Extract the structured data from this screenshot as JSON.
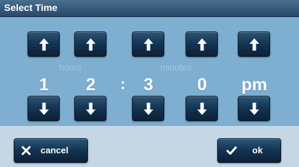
{
  "window": {
    "title": "Select Time"
  },
  "picker": {
    "hours_label": "hours",
    "minutes_label": "minutes",
    "hour_tens": "1",
    "hour_ones": "2",
    "separator": ":",
    "minute_tens": "3",
    "minute_ones": "0",
    "ampm": "pm"
  },
  "footer": {
    "cancel_label": "cancel",
    "ok_label": "ok"
  },
  "icons": {
    "up": "arrow-up-icon",
    "down": "arrow-down-icon",
    "cancel": "x-icon",
    "ok": "checkmark-icon"
  },
  "colors": {
    "title_bar": "#2f5276",
    "panel": "#7eaed0",
    "footer": "#c5d6e4",
    "button": "#143350",
    "label": "#a6c7df"
  }
}
